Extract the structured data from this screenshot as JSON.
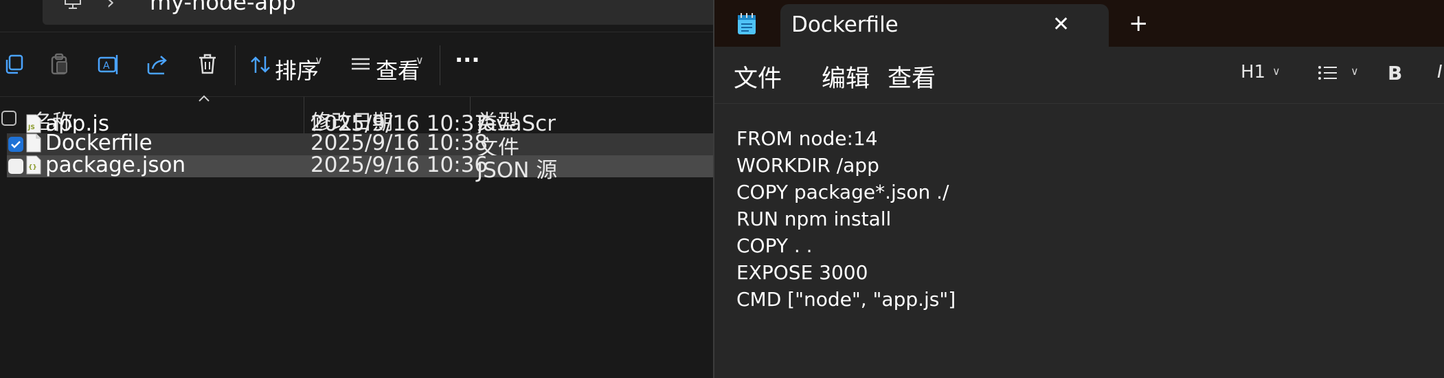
{
  "explorer": {
    "path": "my-node-app",
    "toolbar": {
      "sort_label": "排序",
      "view_label": "查看",
      "more_label": "···"
    },
    "columns": {
      "name": "名称",
      "modified": "修改日期",
      "type": "类型"
    },
    "files": [
      {
        "name": "app.js",
        "modified": "2025/9/16 10:37",
        "type": "JavaScr",
        "icon": "js-file-icon",
        "checked": false
      },
      {
        "name": "Dockerfile",
        "modified": "2025/9/16 10:38",
        "type": "文件",
        "icon": "generic-file-icon",
        "checked": true
      },
      {
        "name": "package.json",
        "modified": "2025/9/16 10:36",
        "type": "JSON 源",
        "icon": "json-file-icon",
        "checked": false
      }
    ]
  },
  "notepad": {
    "tab_title": "Dockerfile",
    "tab_close": "✕",
    "tab_add": "+",
    "menu": {
      "file": "文件",
      "edit": "编辑",
      "view": "查看"
    },
    "format": {
      "heading": "H1",
      "bold": "B"
    },
    "content_lines": [
      "FROM node:14",
      "WORKDIR /app",
      "COPY package*.json ./",
      "RUN npm install",
      "COPY . .",
      "EXPOSE 3000",
      "CMD [\"node\", \"app.js\"]"
    ],
    "colors": {
      "selection_checkbox": "#1f72d6",
      "titlebar": "#1c110c"
    }
  }
}
